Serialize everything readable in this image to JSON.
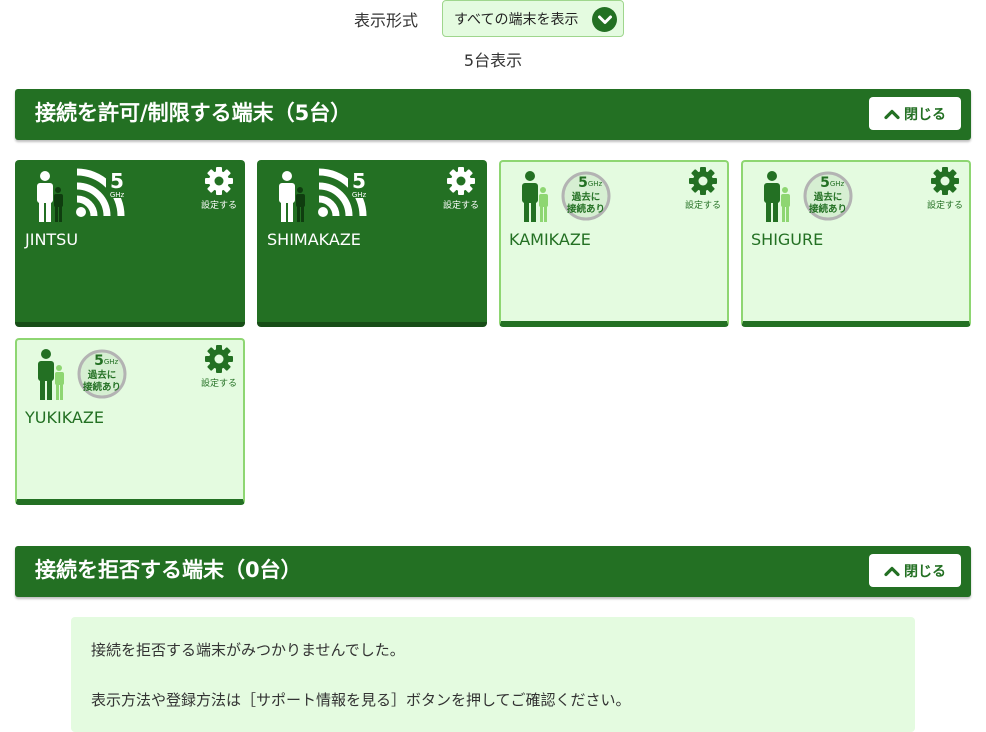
{
  "filter": {
    "label": "表示形式",
    "selected": "すべての端末を表示"
  },
  "count_text": "5台表示",
  "allowed_section": {
    "title": "接続を許可/制限する端末（5台）",
    "close_label": "閉じる",
    "devices": [
      {
        "name": "JINTSU",
        "state": "connected",
        "band": "5",
        "band_unit": "GHz",
        "settings_label": "設定する"
      },
      {
        "name": "SHIMAKAZE",
        "state": "connected",
        "band": "5",
        "band_unit": "GHz",
        "settings_label": "設定する"
      },
      {
        "name": "KAMIKAZE",
        "state": "past",
        "band": "5",
        "band_unit": "GHz",
        "past_label_1": "過去に",
        "past_label_2": "接続あり",
        "settings_label": "設定する"
      },
      {
        "name": "SHIGURE",
        "state": "past",
        "band": "5",
        "band_unit": "GHz",
        "past_label_1": "過去に",
        "past_label_2": "接続あり",
        "settings_label": "設定する"
      },
      {
        "name": "YUKIKAZE",
        "state": "past",
        "band": "5",
        "band_unit": "GHz",
        "past_label_1": "過去に",
        "past_label_2": "接続あり",
        "settings_label": "設定する"
      }
    ]
  },
  "denied_section": {
    "title": "接続を拒否する端末（0台）",
    "close_label": "閉じる",
    "message_1": "接続を拒否する端末がみつかりませんでした。",
    "message_2": "表示方法や登録方法は［サポート情報を見る］ボタンを押してご確認ください。"
  },
  "colors": {
    "brand_green": "#237023",
    "light_green_bg": "#e4fbe0",
    "light_green_border": "#8ed672"
  },
  "icons": [
    "chevron-down-icon",
    "chevron-up-icon",
    "person-icon",
    "wifi-5ghz-icon",
    "past-connection-icon",
    "gear-icon"
  ]
}
